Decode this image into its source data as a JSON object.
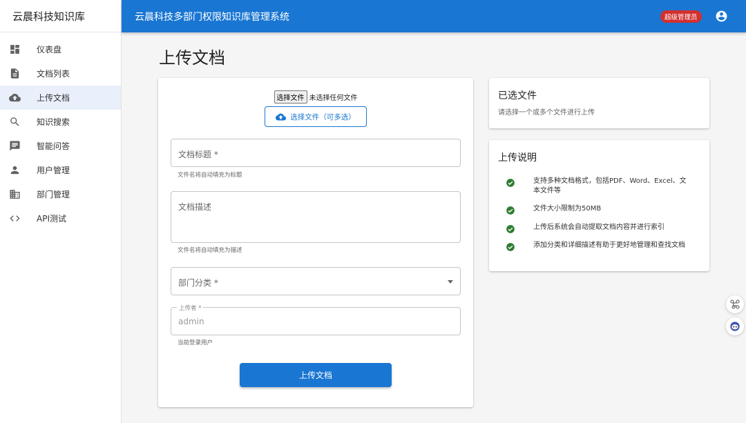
{
  "sidebar": {
    "brand": "云晨科技知识库",
    "items": [
      {
        "label": "仪表盘",
        "icon": "dashboard-icon"
      },
      {
        "label": "文档列表",
        "icon": "document-icon"
      },
      {
        "label": "上传文档",
        "icon": "cloud-upload-icon",
        "active": true
      },
      {
        "label": "知识搜索",
        "icon": "search-icon"
      },
      {
        "label": "智能问答",
        "icon": "chat-icon"
      },
      {
        "label": "用户管理",
        "icon": "person-icon"
      },
      {
        "label": "部门管理",
        "icon": "building-icon"
      },
      {
        "label": "API测试",
        "icon": "code-icon"
      }
    ]
  },
  "appbar": {
    "title": "云晨科技多部门权限知识库管理系统",
    "role_badge": "超级管理员"
  },
  "page": {
    "title": "上传文档"
  },
  "form": {
    "native_file_button": "选择文件",
    "native_file_status": "未选择任何文件",
    "choose_button": "选择文件（可多选）",
    "title_label": "文档标题 *",
    "title_helper": "文件名将自动填充为标题",
    "desc_label": "文档描述",
    "desc_helper": "文件名将自动填充为描述",
    "dept_label": "部门分类 *",
    "uploader_label": "上传者 *",
    "uploader_value": "admin",
    "uploader_helper": "当前登录用户",
    "submit": "上传文档"
  },
  "selected_files": {
    "title": "已选文件",
    "hint": "请选择一个或多个文件进行上传"
  },
  "instructions": {
    "title": "上传说明",
    "items": [
      "支持多种文档格式，包括PDF、Word、Excel、文本文件等",
      "文件大小限制为50MB",
      "上传后系统会自动提取文档内容并进行索引",
      "添加分类和详细描述有助于更好地管理和查找文档"
    ]
  },
  "colors": {
    "primary": "#1976d2",
    "badge": "#d32f2f",
    "success": "#2e7d32",
    "active_nav_bg": "#e9f0fb"
  }
}
